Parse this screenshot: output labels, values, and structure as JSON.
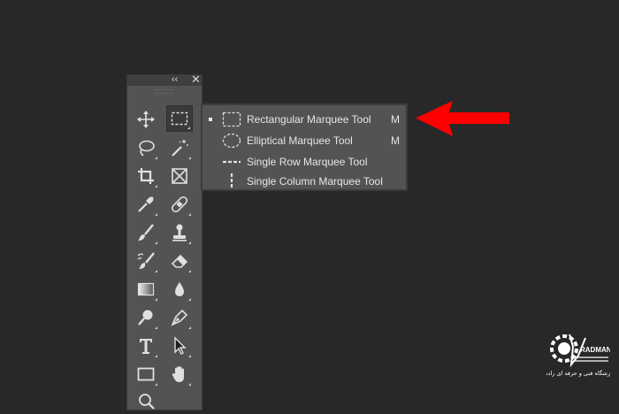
{
  "toolbar": {
    "collapse_glyph": "‹‹",
    "close_glyph": "✕",
    "tools": [
      {
        "name": "move-tool",
        "icon": "move-icon"
      },
      {
        "name": "rectangular-marquee-tool",
        "icon": "rect-marquee-icon",
        "active": true
      },
      {
        "name": "lasso-tool",
        "icon": "lasso-icon"
      },
      {
        "name": "magic-wand-tool",
        "icon": "magic-wand-icon"
      },
      {
        "name": "crop-tool",
        "icon": "crop-icon"
      },
      {
        "name": "frame-tool",
        "icon": "frame-icon"
      },
      {
        "name": "eyedropper-tool",
        "icon": "eyedropper-icon"
      },
      {
        "name": "healing-brush-tool",
        "icon": "bandage-icon"
      },
      {
        "name": "brush-tool",
        "icon": "brush-icon"
      },
      {
        "name": "clone-stamp-tool",
        "icon": "stamp-icon"
      },
      {
        "name": "history-brush-tool",
        "icon": "history-brush-icon"
      },
      {
        "name": "eraser-tool",
        "icon": "eraser-icon"
      },
      {
        "name": "gradient-tool",
        "icon": "gradient-icon"
      },
      {
        "name": "blur-tool",
        "icon": "drop-icon"
      },
      {
        "name": "dodge-tool",
        "icon": "dodge-icon"
      },
      {
        "name": "pen-tool",
        "icon": "pen-icon"
      },
      {
        "name": "type-tool",
        "icon": "type-icon"
      },
      {
        "name": "path-selection-tool",
        "icon": "arrow-cursor-icon"
      },
      {
        "name": "rectangle-tool",
        "icon": "rectangle-icon"
      },
      {
        "name": "hand-tool",
        "icon": "hand-icon"
      },
      {
        "name": "zoom-tool",
        "icon": "zoom-icon"
      }
    ]
  },
  "flyout": {
    "items": [
      {
        "label": "Rectangular Marquee Tool",
        "shortcut": "M",
        "selected": true,
        "icon": "rect-marquee-icon"
      },
      {
        "label": "Elliptical Marquee Tool",
        "shortcut": "M",
        "selected": false,
        "icon": "ellipse-marquee-icon"
      },
      {
        "label": "Single Row Marquee Tool",
        "shortcut": "",
        "selected": false,
        "icon": "single-row-icon"
      },
      {
        "label": "Single Column Marquee Tool",
        "shortcut": "",
        "selected": false,
        "icon": "single-column-icon"
      }
    ]
  },
  "annotation": {
    "color": "#ff0000",
    "icon": "red-arrow-icon"
  },
  "watermark": {
    "text": "RADMAN",
    "subtitle": "آموزشگاه فنی و حرفه ای رادمان"
  }
}
